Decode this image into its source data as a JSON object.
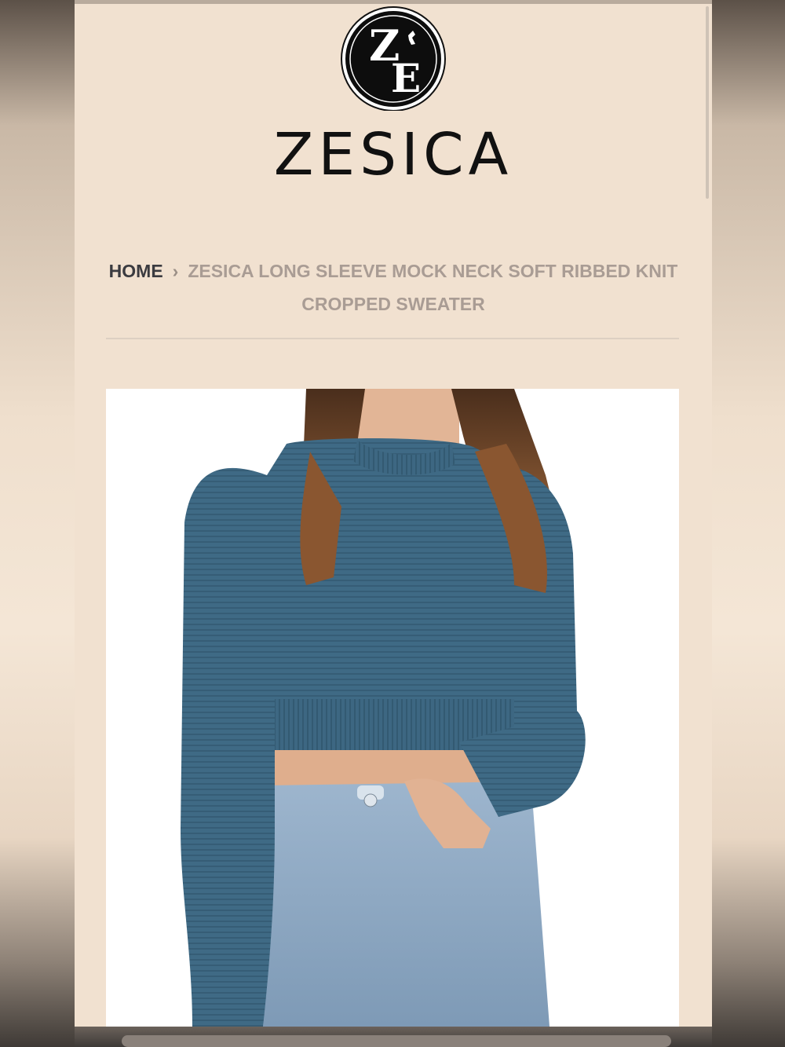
{
  "brand": {
    "logo_monogram": "ZE",
    "name": "ZESICA"
  },
  "breadcrumb": {
    "home": "HOME",
    "separator": "›",
    "current": "ZESICA LONG SLEEVE MOCK NECK SOFT RIBBED KNIT CROPPED SWEATER"
  },
  "product_image": {
    "icon": "product-photo-sweater",
    "sweater_color": "#3f6a85"
  },
  "colors": {
    "page_background": "#f1e1d0",
    "brand_text": "#111111",
    "breadcrumb_home": "#3b3b40",
    "breadcrumb_current": "#a99c94"
  }
}
